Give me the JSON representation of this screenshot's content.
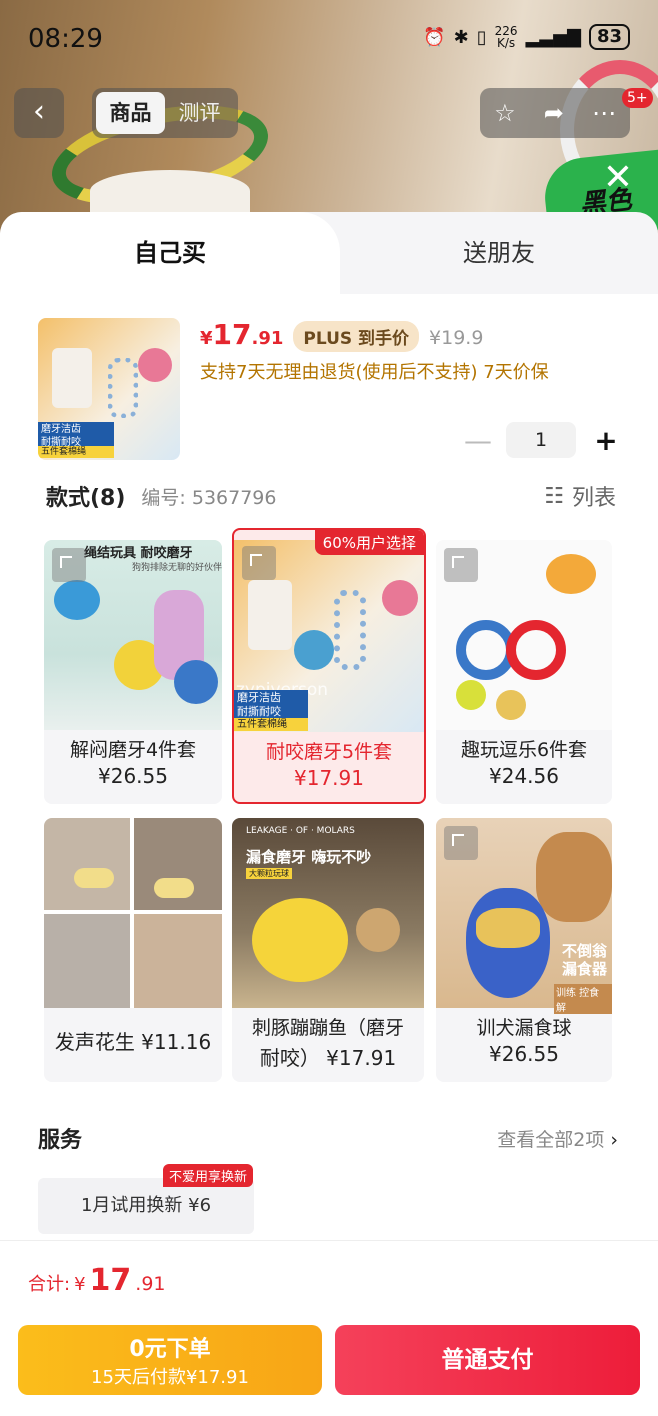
{
  "status_bar": {
    "time": "08:29",
    "net_speed_value": "226",
    "net_speed_unit": "K/s",
    "battery": "83"
  },
  "nav": {
    "tabs": [
      {
        "label": "商品"
      },
      {
        "label": "测评"
      }
    ],
    "badge": "5+"
  },
  "background": {
    "badge_text": "黑色"
  },
  "purchase_tabs": {
    "self": "自己买",
    "friend": "送朋友"
  },
  "summary": {
    "thumb_caption_1": "磨牙洁齿",
    "thumb_caption_2": "耐撕耐咬",
    "thumb_caption_3": "五件套棉绳",
    "currency": "¥",
    "price_int": "17",
    "price_dec": ".91",
    "plus_label": "PLUS 到手价",
    "original_price": "¥19.9",
    "service_text": "支持7天无理由退货(使用后不支持)  7天价保",
    "quantity": "1"
  },
  "styles": {
    "title": "款式(8)",
    "code": "编号: 5367796",
    "list_label": "列表",
    "items": [
      {
        "name": "解闷磨牙4件套",
        "price": "¥26.55",
        "img_text": "绳结玩具 耐咬磨牙",
        "img_sub": "狗狗排除无聊的好伙伴"
      },
      {
        "name": "耐咬磨牙5件套",
        "price": "¥17.91",
        "ribbon": "60%用户选择",
        "img_text": "磨牙洁齿",
        "img_sub": "耐撕耐咬",
        "img_sub2": "五件套棉绳",
        "watermark": "zypiverson"
      },
      {
        "name": "趣玩逗乐6件套",
        "price": "¥24.56"
      },
      {
        "name": "发声花生 ¥11.16",
        "price": ""
      },
      {
        "name": "刺豚蹦蹦鱼（磨牙",
        "price": "耐咬） ¥17.91",
        "img_text": "漏食磨牙 嗨玩不吵",
        "img_top": "LEAKAGE · OF · MOLARS",
        "img_tag": "大颗粒玩球"
      },
      {
        "name": "训犬漏食球",
        "price": "¥26.55",
        "img_text": "不倒翁",
        "img_text2": "漏食器",
        "img_sub": "训练 控食 解"
      }
    ]
  },
  "services": {
    "title": "服务",
    "more": "查看全部2项",
    "chip": "1月试用换新  ¥6",
    "chip_tag": "不爱用享换新"
  },
  "bottom": {
    "total_label": "合计:",
    "currency": "¥",
    "total_int": "17",
    "total_dec": ".91",
    "later_line1": "0元下单",
    "later_line2": "15天后付款¥17.91",
    "pay_label": "普通支付"
  },
  "colors": {
    "accent": "#e4262f",
    "gold": "#f8a516",
    "plus_bg": "#f7e4c8"
  }
}
